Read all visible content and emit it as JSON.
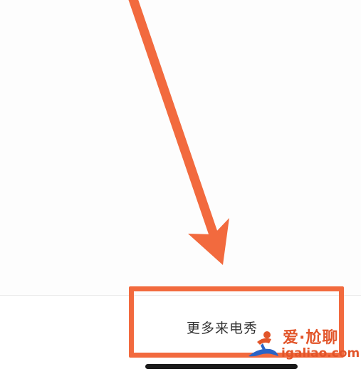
{
  "bottom_bar": {
    "more_ringtones_label": "更多来电秀"
  },
  "watermark": {
    "brand_text": "爱·尬聊",
    "url_text": "igaliao.com"
  },
  "annotation": {
    "arrow_color": "#f26a3e",
    "highlight_color": "#f26a3e"
  }
}
